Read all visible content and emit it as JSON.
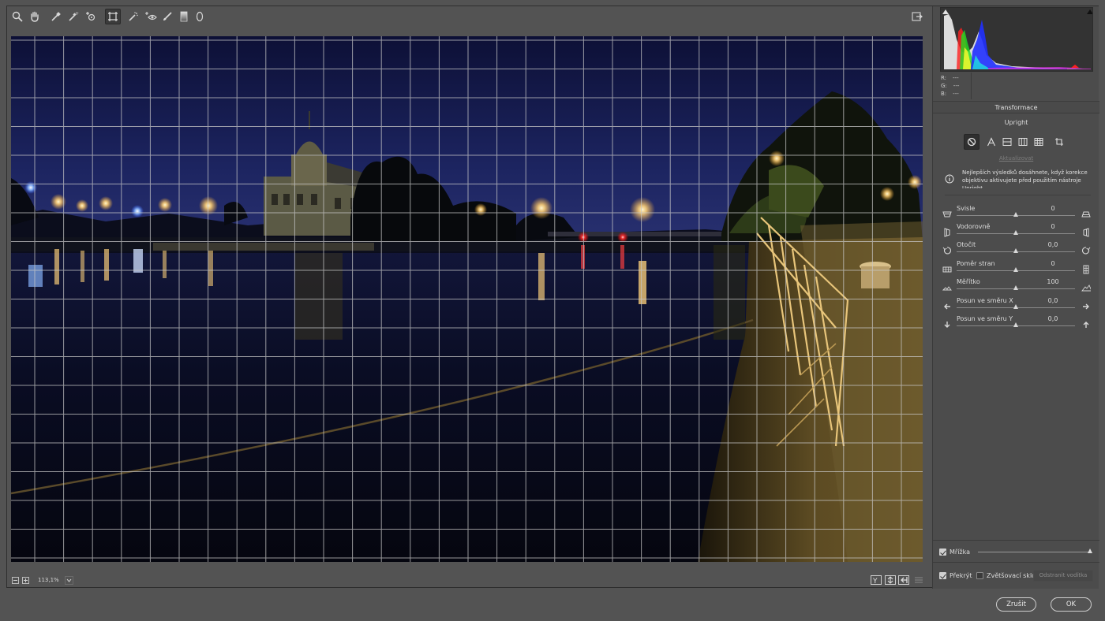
{
  "toolbar": {
    "tools": [
      "zoom-icon",
      "hand-icon",
      "white-balance-icon",
      "color-sampler-icon",
      "targeted-adjustment-icon",
      "transform-icon",
      "spot-removal-icon",
      "red-eye-icon",
      "adjustment-brush-icon",
      "graduated-filter-icon",
      "radial-filter-icon"
    ],
    "active_tool": "transform-icon"
  },
  "bottombar": {
    "zoom_value": "113,1%"
  },
  "histogram": {
    "r_label": "R:",
    "r_value": "---",
    "g_label": "G:",
    "g_value": "---",
    "b_label": "B:",
    "b_value": "---"
  },
  "panel": {
    "section_title": "Transformace",
    "upright_title": "Upright",
    "update_link": "Aktualizovat",
    "info_text": "Nejlepších výsledků dosáhnete, když korekce objektivu aktivujete před použitím nástroje Upright.",
    "sliders": [
      {
        "label": "Svisle",
        "value": "0",
        "pos": 0.5
      },
      {
        "label": "Vodorovně",
        "value": "0",
        "pos": 0.5
      },
      {
        "label": "Otočit",
        "value": "0,0",
        "pos": 0.5
      },
      {
        "label": "Poměr stran",
        "value": "0",
        "pos": 0.5
      },
      {
        "label": "Měřítko",
        "value": "100",
        "pos": 0.5
      },
      {
        "label": "Posun ve směru X",
        "value": "0,0",
        "pos": 0.5
      },
      {
        "label": "Posun ve směru Y",
        "value": "0,0",
        "pos": 0.5
      }
    ],
    "grid_label": "Mřížka",
    "grid_level": 1.0,
    "overlay_label": "Překrýt",
    "loupe_label": "Zvětšovací sklo",
    "clear_guides_label": "Odstranit vodítka"
  },
  "dialog": {
    "cancel_label": "Zrušit",
    "ok_label": "OK"
  },
  "colors": {
    "background": "#535353",
    "panel": "#4c4c4c",
    "sky": "#161b4a",
    "water": "#070a1c",
    "light": "#ffd27a"
  }
}
